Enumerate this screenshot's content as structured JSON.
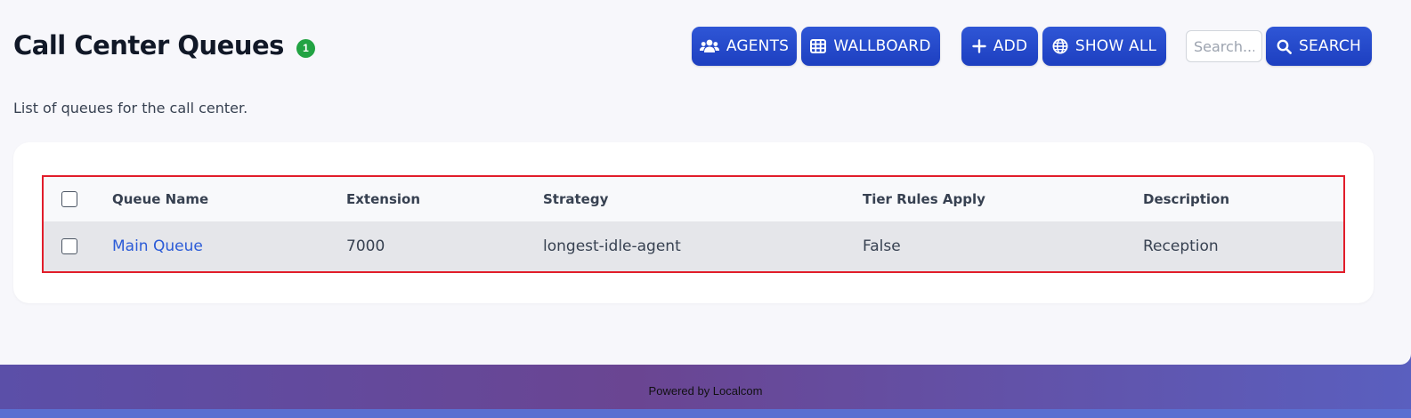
{
  "header": {
    "title": "Call Center Queues",
    "count_badge": "1",
    "subtitle": "List of queues for the call center."
  },
  "toolbar": {
    "agents_label": "AGENTS",
    "wallboard_label": "WALLBOARD",
    "add_label": "ADD",
    "show_all_label": "SHOW ALL",
    "search_placeholder": "Search...",
    "search_value": "",
    "search_label": "SEARCH"
  },
  "table": {
    "columns": [
      "Queue Name",
      "Extension",
      "Strategy",
      "Tier Rules Apply",
      "Description"
    ],
    "rows": [
      {
        "queue_name": "Main Queue",
        "extension": "7000",
        "strategy": "longest-idle-agent",
        "tier_rules_apply": "False",
        "description": "Reception"
      }
    ]
  },
  "footer": {
    "text": "Powered by Localcom"
  },
  "icons": {
    "agents": "users-icon",
    "wallboard": "grid-table-icon",
    "add": "plus-icon",
    "show_all": "globe-icon",
    "search": "search-icon"
  },
  "colors": {
    "accent": "#2346cc",
    "badge": "#22a343",
    "link": "#2b5bd7",
    "highlight_border": "#e11d2a"
  }
}
